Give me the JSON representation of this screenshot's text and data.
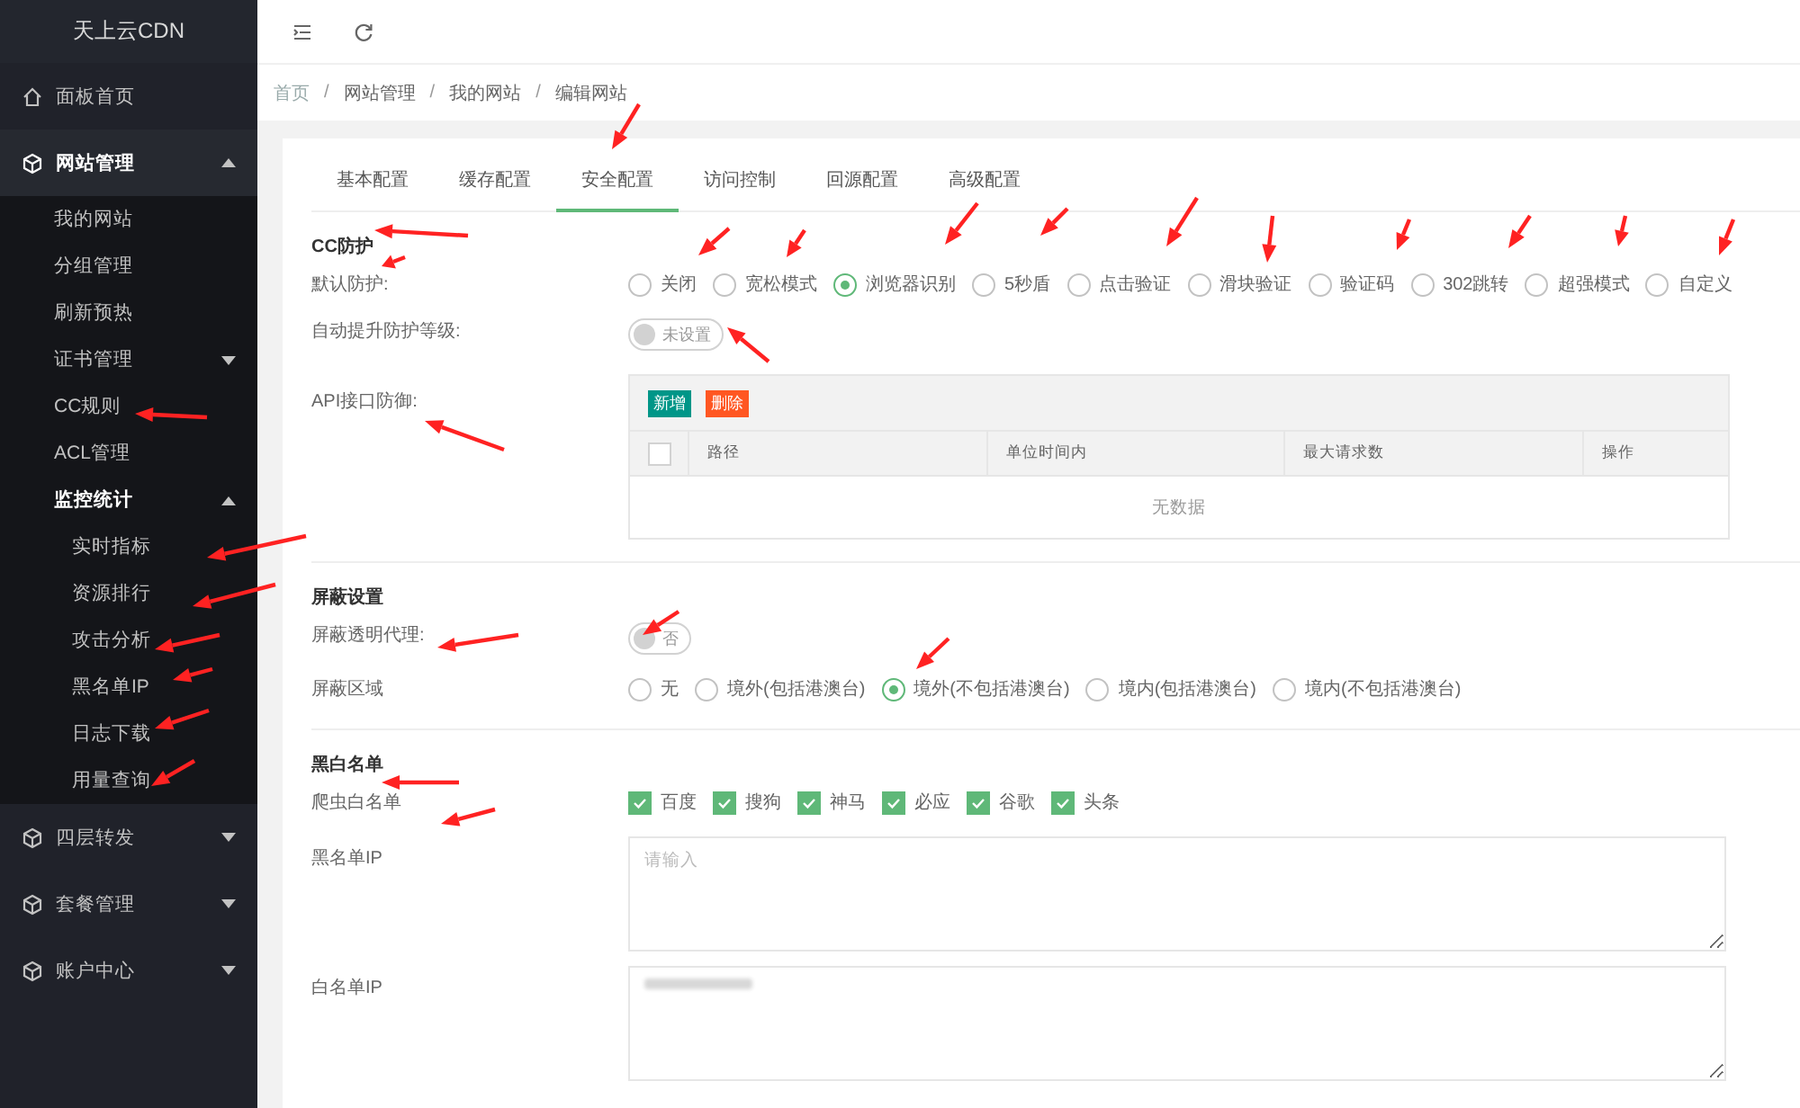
{
  "sidebar": {
    "title": "天上云CDN",
    "items": [
      {
        "label": "面板首页"
      },
      {
        "label": "网站管理",
        "expanded": true,
        "children": [
          {
            "label": "我的网站"
          },
          {
            "label": "分组管理"
          },
          {
            "label": "刷新预热"
          },
          {
            "label": "证书管理",
            "expanded": false
          },
          {
            "label": "CC规则"
          },
          {
            "label": "ACL管理"
          },
          {
            "label": "监控统计",
            "expanded": true,
            "children": [
              {
                "label": "实时指标"
              },
              {
                "label": "资源排行"
              },
              {
                "label": "攻击分析"
              },
              {
                "label": "黑名单IP"
              },
              {
                "label": "日志下载"
              },
              {
                "label": "用量查询"
              }
            ]
          }
        ]
      },
      {
        "label": "四层转发",
        "expanded": false
      },
      {
        "label": "套餐管理",
        "expanded": false
      },
      {
        "label": "账户中心",
        "expanded": false
      }
    ]
  },
  "breadcrumb": {
    "separator": "/",
    "items": [
      {
        "label": "首页",
        "kind": "link"
      },
      {
        "label": "网站管理",
        "kind": "text"
      },
      {
        "label": "我的网站",
        "kind": "text"
      },
      {
        "label": "编辑网站",
        "kind": "text"
      }
    ]
  },
  "tabs": [
    {
      "label": "基本配置",
      "selected": false
    },
    {
      "label": "缓存配置",
      "selected": false
    },
    {
      "label": "安全配置",
      "selected": true
    },
    {
      "label": "访问控制",
      "selected": false
    },
    {
      "label": "回源配置",
      "selected": false
    },
    {
      "label": "高级配置",
      "selected": false
    }
  ],
  "sections": [
    {
      "title": "CC防护",
      "fields": [
        {
          "label": "默认防护:",
          "kind": "radio",
          "options": [
            {
              "label": "关闭",
              "selected": false
            },
            {
              "label": "宽松模式",
              "selected": false
            },
            {
              "label": "浏览器识别",
              "selected": true
            },
            {
              "label": "5秒盾",
              "selected": false
            },
            {
              "label": "点击验证",
              "selected": false
            },
            {
              "label": "滑块验证",
              "selected": false
            },
            {
              "label": "验证码",
              "selected": false
            },
            {
              "label": "302跳转",
              "selected": false
            },
            {
              "label": "超强模式",
              "selected": false
            },
            {
              "label": "自定义",
              "selected": false
            }
          ]
        },
        {
          "label": "自动提升防护等级:",
          "kind": "switch",
          "on": false,
          "text": "未设置"
        },
        {
          "label": "API接口防御:",
          "kind": "table",
          "buttons": [
            {
              "label": "新增",
              "kind": "add"
            },
            {
              "label": "删除",
              "kind": "delete"
            }
          ],
          "select_all": false,
          "columns": [
            "路径",
            "单位时间内",
            "最大请求数",
            "操作"
          ],
          "empty_text": "无数据"
        }
      ]
    },
    {
      "title": "屏蔽设置",
      "fields": [
        {
          "label": "屏蔽透明代理:",
          "kind": "switch",
          "on": false,
          "text": "否"
        },
        {
          "label": "屏蔽区域",
          "kind": "radio",
          "options": [
            {
              "label": "无",
              "selected": false
            },
            {
              "label": "境外(包括港澳台)",
              "selected": false
            },
            {
              "label": "境外(不包括港澳台)",
              "selected": true
            },
            {
              "label": "境内(包括港澳台)",
              "selected": false
            },
            {
              "label": "境内(不包括港澳台)",
              "selected": false
            }
          ]
        }
      ]
    },
    {
      "title": "黑白名单",
      "fields": [
        {
          "label": "爬虫白名单",
          "kind": "checkbox",
          "options": [
            {
              "label": "百度",
              "checked": true
            },
            {
              "label": "搜狗",
              "checked": true
            },
            {
              "label": "神马",
              "checked": true
            },
            {
              "label": "必应",
              "checked": true
            },
            {
              "label": "谷歌",
              "checked": true
            },
            {
              "label": "头条",
              "checked": true
            }
          ]
        },
        {
          "label": "黑名单IP",
          "kind": "textarea",
          "placeholder": "请输入"
        },
        {
          "label": "白名单IP",
          "kind": "textarea",
          "blurred": true
        }
      ]
    }
  ]
}
